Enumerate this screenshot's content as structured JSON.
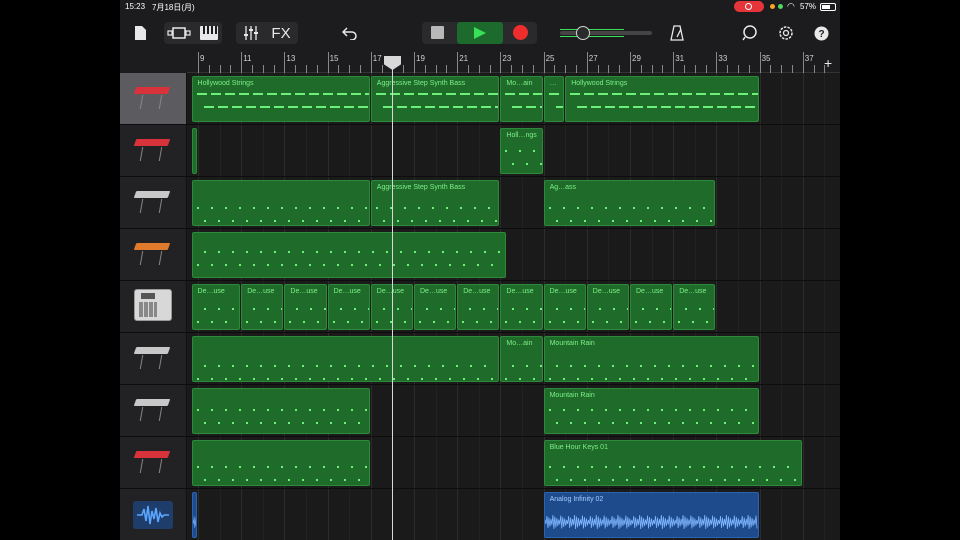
{
  "status": {
    "time": "15:23",
    "date": "7月18日(月)",
    "battery": "57%"
  },
  "toolbar": {
    "fx_label": "FX"
  },
  "ruler": {
    "bars": [
      "9",
      "11",
      "13",
      "15",
      "17",
      "19",
      "21",
      "23",
      "25",
      "27",
      "29",
      "31",
      "33",
      "35",
      "37"
    ]
  },
  "tracks": [
    {
      "instrument": "keyboard-red",
      "regions": [
        {
          "label": "Hollywood Strings"
        },
        {
          "label": "Aggressive Step Synth Bass"
        },
        {
          "label": "Mo…ain"
        },
        {
          "label": "…"
        },
        {
          "label": "Hollywood Strings"
        }
      ]
    },
    {
      "instrument": "keyboard-red",
      "regions": [
        {
          "label": ""
        },
        {
          "label": "Holl…ngs"
        }
      ]
    },
    {
      "instrument": "keyboard-silver",
      "regions": [
        {
          "label": ""
        },
        {
          "label": "Aggressive Step Synth Bass"
        },
        {
          "label": "Ag…ass"
        }
      ]
    },
    {
      "instrument": "keyboard-orange",
      "regions": [
        {
          "label": ""
        }
      ]
    },
    {
      "instrument": "drum-machine",
      "regions": [
        {
          "label": "De…use"
        },
        {
          "label": "De…use"
        },
        {
          "label": "De…use"
        },
        {
          "label": "De…use"
        },
        {
          "label": "De…use"
        },
        {
          "label": "De…use"
        },
        {
          "label": "De…use"
        },
        {
          "label": "De…use"
        },
        {
          "label": "De…use"
        },
        {
          "label": "De…use"
        },
        {
          "label": "De…use"
        },
        {
          "label": "De…use"
        }
      ]
    },
    {
      "instrument": "keyboard-silver",
      "regions": [
        {
          "label": ""
        },
        {
          "label": "Mo…ain"
        },
        {
          "label": "Mountain Rain"
        }
      ]
    },
    {
      "instrument": "keyboard-silver",
      "regions": [
        {
          "label": ""
        },
        {
          "label": "Mountain Rain"
        }
      ]
    },
    {
      "instrument": "keyboard-red",
      "regions": [
        {
          "label": ""
        },
        {
          "label": "Blue Hour Keys 01"
        }
      ]
    },
    {
      "instrument": "audio-waveform",
      "regions": [
        {
          "label": ""
        },
        {
          "label": "Analog Infinity 02"
        }
      ]
    }
  ]
}
